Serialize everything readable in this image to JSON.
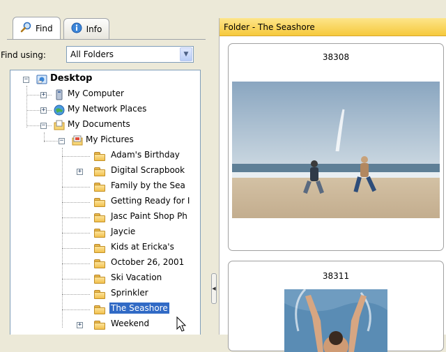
{
  "tabs": [
    {
      "label": "Find",
      "icon": "magnifier-icon",
      "active": true
    },
    {
      "label": "Info",
      "icon": "info-icon",
      "active": false
    }
  ],
  "find_using": {
    "label": "Find using:",
    "value": "All Folders"
  },
  "tree": {
    "root": "Desktop",
    "items": [
      {
        "label": "My Computer",
        "icon": "computer-icon",
        "expander": "+"
      },
      {
        "label": "My Network Places",
        "icon": "network-icon",
        "expander": "+"
      },
      {
        "label": "My Documents",
        "icon": "documents-folder-icon",
        "expander": "-"
      },
      {
        "label": "My Pictures",
        "icon": "pictures-folder-icon",
        "expander": "-"
      }
    ],
    "folders": [
      {
        "label": "Adam's Birthday",
        "expander": ""
      },
      {
        "label": "Digital Scrapbook",
        "expander": "+"
      },
      {
        "label": "Family by the Sea",
        "expander": ""
      },
      {
        "label": "Getting Ready for I",
        "expander": ""
      },
      {
        "label": "Jasc Paint Shop Ph",
        "expander": ""
      },
      {
        "label": "Jaycie",
        "expander": ""
      },
      {
        "label": "Kids at Ericka's",
        "expander": ""
      },
      {
        "label": "October 26, 2001",
        "expander": ""
      },
      {
        "label": "Ski Vacation",
        "expander": ""
      },
      {
        "label": "Sprinkler",
        "expander": ""
      },
      {
        "label": "The Seashore",
        "expander": "",
        "selected": true
      },
      {
        "label": "Weekend",
        "expander": "+"
      }
    ]
  },
  "folder_header": "Folder - The Seashore",
  "thumbnails": [
    {
      "title": "38308"
    },
    {
      "title": "38311"
    }
  ],
  "colors": {
    "header_yellow": "#f6c93c",
    "selection_blue": "#316ac5"
  }
}
